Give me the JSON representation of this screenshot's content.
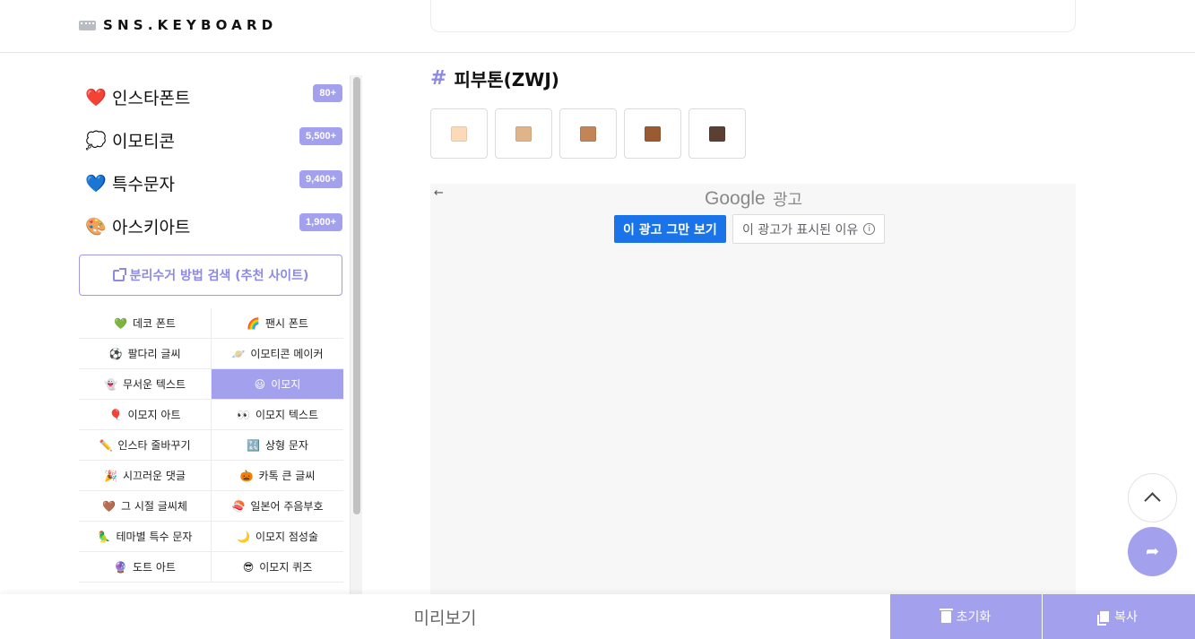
{
  "header": {
    "logo_text": "SNS.KEYBOARD"
  },
  "sidebar": {
    "categories": [
      {
        "emoji": "❤️",
        "label": "인스타폰트",
        "badge": "80+"
      },
      {
        "emoji": "💭",
        "label": "이모티콘",
        "badge": "5,500+"
      },
      {
        "emoji": "💙",
        "label": "특수문자",
        "badge": "9,400+"
      },
      {
        "emoji": "🎨",
        "label": "아스키아트",
        "badge": "1,900+"
      }
    ],
    "recommend_label": "분리수거 방법 검색 (추천 사이트)",
    "links": [
      {
        "icon": "💚",
        "label": "데코 폰트"
      },
      {
        "icon": "🌈",
        "label": "팬시 폰트"
      },
      {
        "icon": "⚽",
        "label": "팔다리 글씨"
      },
      {
        "icon": "🪐",
        "label": "이모티콘 메이커"
      },
      {
        "icon": "👻",
        "label": "무서운 텍스트"
      },
      {
        "icon": "😃",
        "label": "이모지"
      },
      {
        "icon": "🎈",
        "label": "이모지 아트"
      },
      {
        "icon": "👀",
        "label": "이모지 텍스트"
      },
      {
        "icon": "✏️",
        "label": "인스타 줄바꾸기"
      },
      {
        "icon": "🔣",
        "label": "상형 문자"
      },
      {
        "icon": "🎉",
        "label": "시끄러운 댓글"
      },
      {
        "icon": "🎃",
        "label": "카톡 큰 글씨"
      },
      {
        "icon": "🤎",
        "label": "그 시절 글씨체"
      },
      {
        "icon": "🍣",
        "label": "일본어 주음부호"
      },
      {
        "icon": "🦜",
        "label": "테마별 특수 문자"
      },
      {
        "icon": "🌙",
        "label": "이모지 점성술"
      },
      {
        "icon": "🔮",
        "label": "도트 아트"
      },
      {
        "icon": "😎",
        "label": "이모지 퀴즈"
      }
    ]
  },
  "main": {
    "section_hash": "#",
    "section_title": "피부톤(ZWJ)",
    "skin_tones": [
      "#fcd9b8",
      "#e0b48b",
      "#c38457",
      "#9a5a32",
      "#5c3f33"
    ]
  },
  "ad": {
    "back_arrow": "←",
    "brand": "Google",
    "label": "광고",
    "stop_label": "이 광고 그만 보기",
    "why_label": "이 광고가 표시된 이유",
    "info_glyph": "i"
  },
  "bottom": {
    "preview_label": "미리보기",
    "reset_label": "초기화",
    "copy_label": "복사"
  },
  "fab": {
    "share_glyph": "➦"
  },
  "colors": {
    "accent": "#a3a0ee",
    "accent_text": "#8d8ae6",
    "google_blue": "#1a73e8"
  }
}
